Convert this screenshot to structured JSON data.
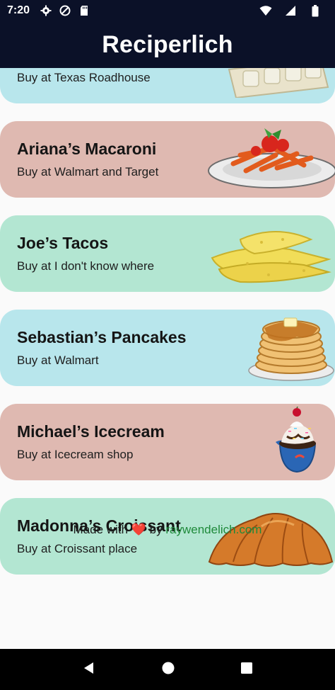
{
  "status_bar": {
    "time": "7:20"
  },
  "app_bar": {
    "title": "Reciperlich"
  },
  "recipes": [
    {
      "name": "",
      "subtitle": "Buy at Texas Roadhouse",
      "color": "#b8e6ec",
      "image": "eggs-carton"
    },
    {
      "name": "Ariana’s Macaroni",
      "subtitle": "Buy at Walmart and Target",
      "color": "#dfb9b1",
      "image": "pasta-plate"
    },
    {
      "name": "Joe’s Tacos",
      "subtitle": "Buy at I don't know where",
      "color": "#b3e6d2",
      "image": "tacos"
    },
    {
      "name": "Sebastian’s Pancakes",
      "subtitle": "Buy at Walmart",
      "color": "#b8e6ec",
      "image": "pancakes"
    },
    {
      "name": "Michael’s Icecream",
      "subtitle": "Buy at Icecream shop",
      "color": "#dfb9b1",
      "image": "icecream-sundae"
    },
    {
      "name": "Madonna’s Croissant",
      "subtitle": "Buy at Croissant place",
      "color": "#b3e6d2",
      "image": "croissant"
    }
  ],
  "footer": {
    "made_with": "Made with",
    "heart": "❤️",
    "by": "by",
    "link": "raywendelich.com"
  },
  "nav": {
    "back_icon": "back-triangle-icon",
    "home_icon": "home-circle-icon",
    "recents_icon": "recents-square-icon"
  }
}
